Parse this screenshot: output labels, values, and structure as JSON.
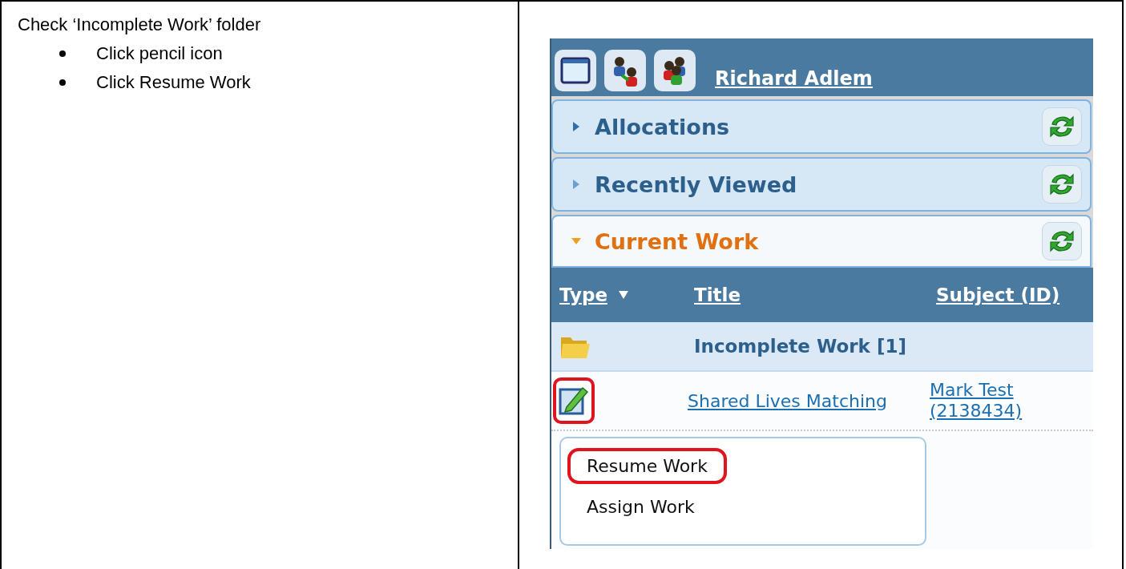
{
  "instructions": {
    "heading": "Check ‘Incomplete Work’ folder",
    "steps": [
      "Click pencil icon",
      "Click Resume Work"
    ]
  },
  "screenshot": {
    "header": {
      "user_name": "Richard Adlem"
    },
    "sections": [
      {
        "title": "Allocations",
        "expanded": false
      },
      {
        "title": "Recently Viewed",
        "expanded": false
      },
      {
        "title": "Current Work",
        "expanded": true
      }
    ],
    "table": {
      "columns": [
        {
          "label": "Type",
          "sorted": true
        },
        {
          "label": "Title",
          "sorted": false
        },
        {
          "label": "Subject (ID)",
          "sorted": false
        }
      ],
      "rows": [
        {
          "kind": "folder",
          "title": "Incomplete Work [1]"
        },
        {
          "kind": "item",
          "title": "Shared Lives Matching",
          "subject": "Mark Test (2138434)",
          "highlighted": true
        }
      ]
    },
    "menu": {
      "items": [
        {
          "label": "Resume Work",
          "highlighted": true
        },
        {
          "label": "Assign Work",
          "highlighted": false
        }
      ]
    }
  }
}
